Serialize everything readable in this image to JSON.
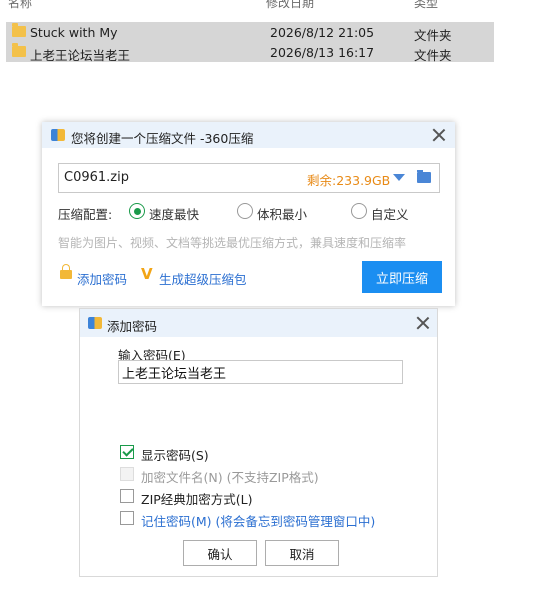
{
  "explorer": {
    "columns": {
      "name": "名称",
      "modified": "修改日期",
      "type": "类型"
    },
    "rows": [
      {
        "name": "Stuck with My",
        "date": "2026/8/12 21:05",
        "type": "文件夹"
      },
      {
        "name": "上老王论坛当老王",
        "date": "2026/8/13 16:17",
        "type": "文件夹"
      }
    ]
  },
  "compress_dialog": {
    "title": "您将创建一个压缩文件 -360压缩",
    "filename": "C0961.zip",
    "free_space": "剩余:233.9GB",
    "config_label": "压缩配置:",
    "options": [
      "速度最快",
      "体积最小",
      "自定义"
    ],
    "selected_option": "速度最快",
    "hint": "智能为图片、视频、文档等挑选最优压缩方式，兼具速度和压缩率",
    "add_password_link": "添加密码",
    "super_pack_link": "生成超级压缩包",
    "compress_button": "立即压缩"
  },
  "password_dialog": {
    "title": "添加密码",
    "input_label": "输入密码(E)",
    "password_value": "上老王论坛当老王",
    "checkboxes": [
      {
        "label": "显示密码(S)",
        "checked": true,
        "disabled": false
      },
      {
        "label": "加密文件名(N) (不支持ZIP格式)",
        "checked": false,
        "disabled": true
      },
      {
        "label": "ZIP经典加密方式(L)",
        "checked": false,
        "disabled": false
      },
      {
        "label": "记住密码(M) (将会备忘到密码管理窗口中)",
        "checked": false,
        "disabled": false
      }
    ],
    "ok_button": "确认",
    "cancel_button": "取消"
  }
}
